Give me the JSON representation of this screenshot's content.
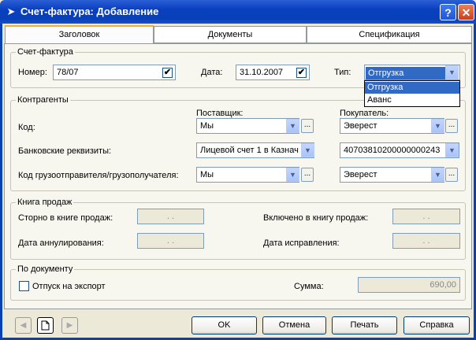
{
  "window": {
    "title": "Счет-фактура: Добавление",
    "help": "?",
    "close": "✕"
  },
  "tabs": [
    {
      "label": "Заголовок",
      "active": true
    },
    {
      "label": "Документы",
      "active": false
    },
    {
      "label": "Спецификация",
      "active": false
    }
  ],
  "invoice": {
    "legend": "Счет-фактура",
    "number_label": "Номер:",
    "number_value": "78/07",
    "date_label": "Дата:",
    "date_value": "31.10.2007",
    "type_label": "Тип:",
    "type_value": "Отгрузка",
    "type_options": [
      "Отгрузка",
      "Аванс"
    ]
  },
  "counterparties": {
    "legend": "Контрагенты",
    "supplier_header": "Поставщик:",
    "buyer_header": "Покупатель:",
    "code_label": "Код:",
    "bank_label": "Банковские реквизиты:",
    "shipper_label": "Код грузоотправителя/грузополучателя:",
    "supplier_code": "Мы",
    "supplier_bank": "Лицевой счет 1 в Казнач",
    "supplier_shipper": "Мы",
    "buyer_code": "Эверест",
    "buyer_bank": "40703810200000000243",
    "buyer_shipper": "Эверест"
  },
  "sales_book": {
    "legend": "Книга продаж",
    "storno_label": "Сторно в книге продаж:",
    "storno_value": ". .",
    "included_label": "Включено в книгу продаж:",
    "included_value": ". .",
    "annul_label": "Дата аннулирования:",
    "annul_value": ". .",
    "correction_label": "Дата исправления:",
    "correction_value": ". ."
  },
  "by_document": {
    "legend": "По документу",
    "export_label": "Отпуск на экспорт",
    "export_checked": false,
    "sum_label": "Сумма:",
    "sum_value": "690,00"
  },
  "buttons": {
    "ok": "OK",
    "cancel": "Отмена",
    "print": "Печать",
    "help": "Справка"
  },
  "icons": {
    "dropdown": "▼",
    "ellipsis": "...",
    "check": "✔",
    "prev": "◀",
    "next": "▶"
  },
  "colors": {
    "titlebar": "#0840b8",
    "selection": "#316ac5"
  }
}
